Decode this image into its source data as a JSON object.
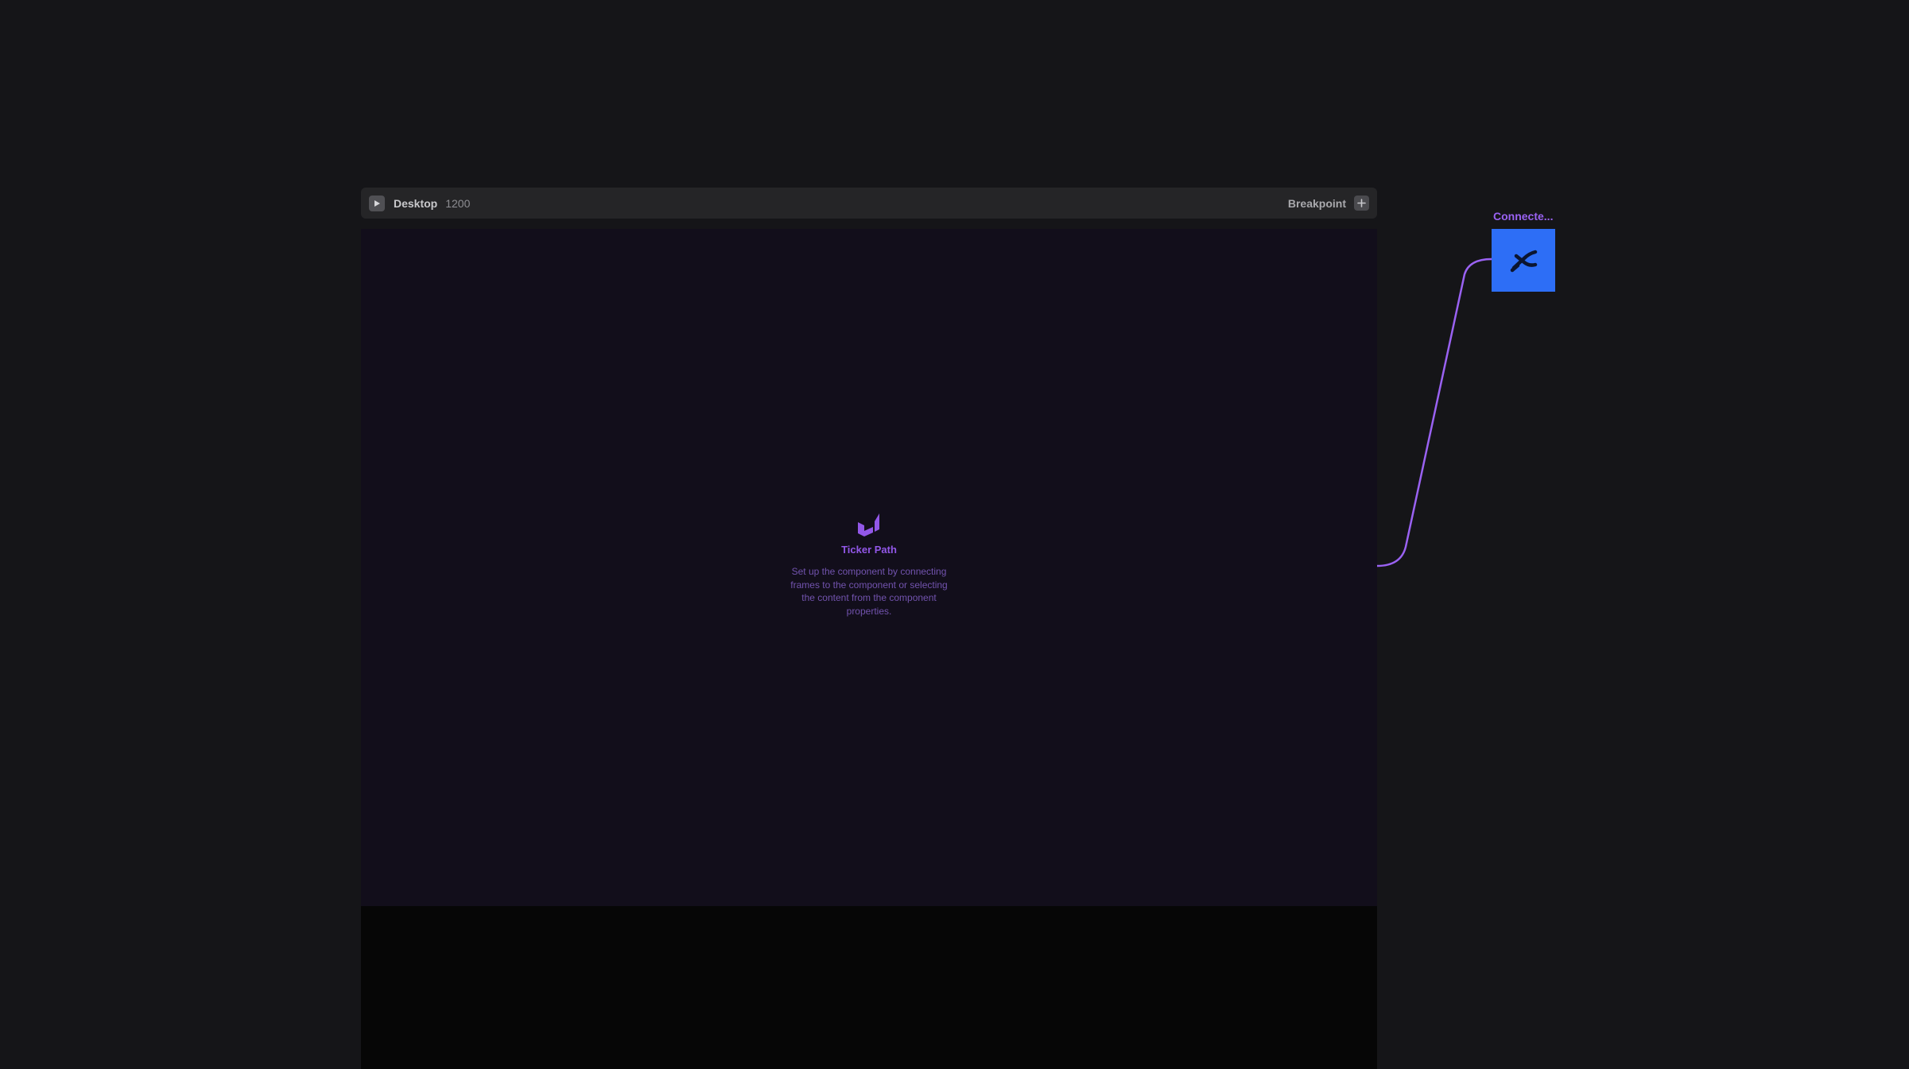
{
  "frame": {
    "name": "Desktop",
    "width_label": "1200",
    "breakpoint_label": "Breakpoint"
  },
  "component": {
    "title": "Ticker Path",
    "description": "Set up the component by connecting frames to the component or selecting the content from the component properties.",
    "icon": "ticker-path-icon"
  },
  "connected_node": {
    "label": "Connecte...",
    "icon": "connected-frame-icon"
  },
  "colors": {
    "canvas_bg": "#151518",
    "frame_bg": "#120e1b",
    "accent_purple": "#9257e8",
    "connector": "#9a62f2",
    "node_blue": "#2d6ef6"
  }
}
